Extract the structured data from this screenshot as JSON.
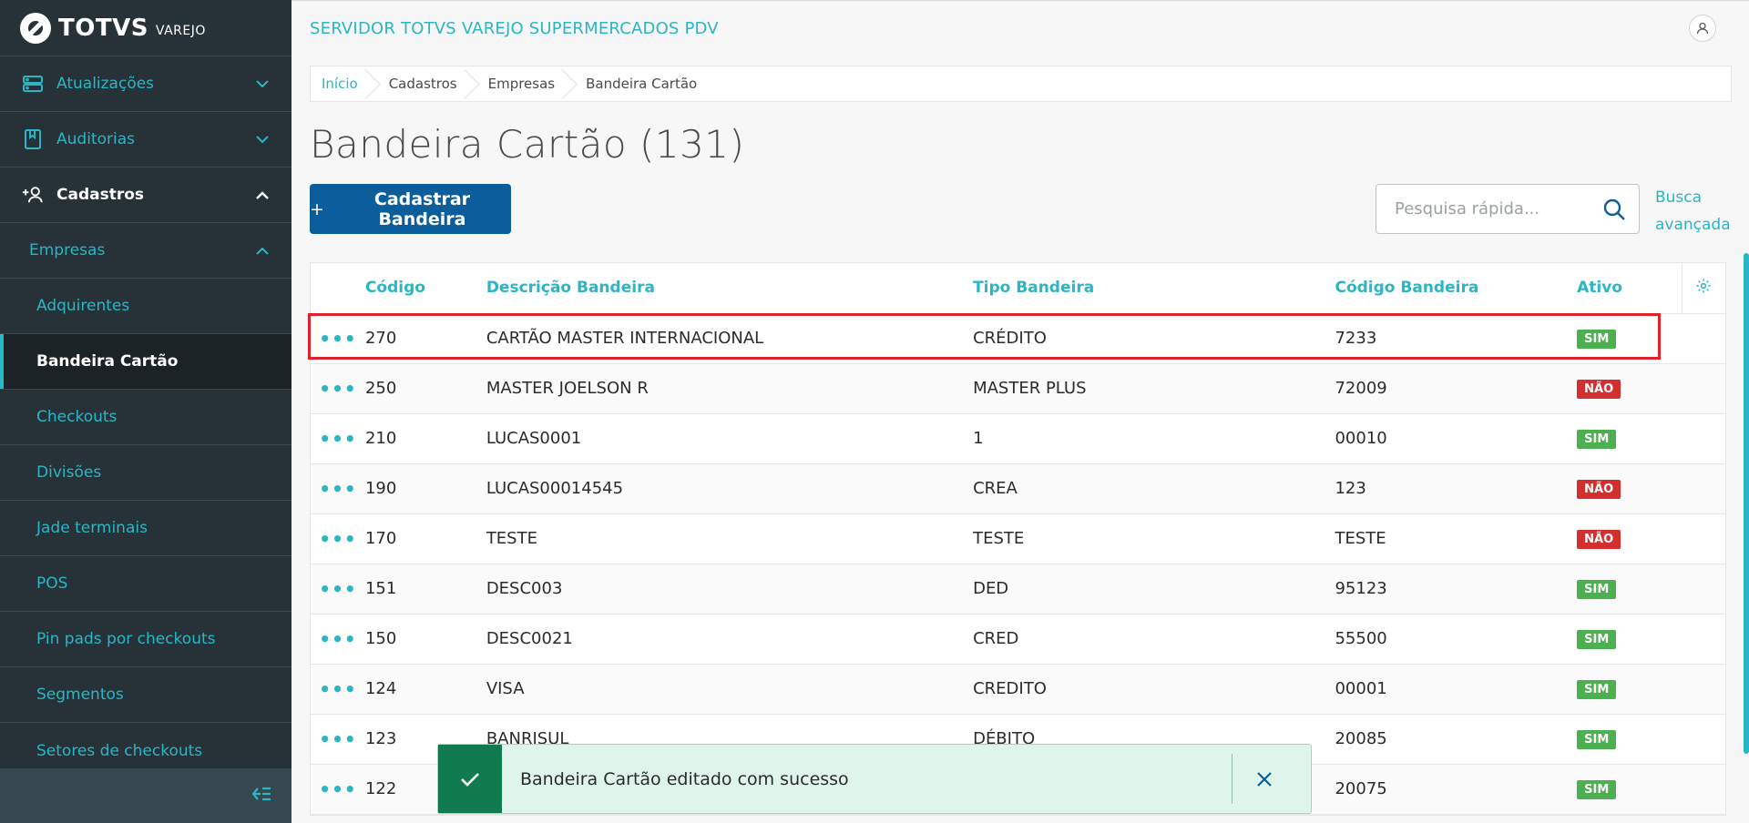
{
  "sidebar": {
    "logo_text": "TOTVS",
    "logo_sub": "VAREJO",
    "items": [
      {
        "label": "Atualizações",
        "icon": "server-icon"
      },
      {
        "label": "Auditorias",
        "icon": "book-icon"
      },
      {
        "label": "Cadastros",
        "icon": "add-user-icon"
      },
      {
        "label": "Empresas"
      },
      {
        "label": "Adquirentes"
      },
      {
        "label": "Bandeira Cartão"
      },
      {
        "label": "Checkouts"
      },
      {
        "label": "Divisões"
      },
      {
        "label": "Jade terminais"
      },
      {
        "label": "POS"
      },
      {
        "label": "Pin pads por checkouts"
      },
      {
        "label": "Segmentos"
      },
      {
        "label": "Setores de checkouts"
      }
    ]
  },
  "header": {
    "app_title": "SERVIDOR TOTVS VAREJO SUPERMERCADOS PDV"
  },
  "breadcrumb": [
    "Início",
    "Cadastros",
    "Empresas",
    "Bandeira Cartão"
  ],
  "page": {
    "title": "Bandeira Cartão (131)",
    "add_button": "Cadastrar Bandeira",
    "search_placeholder": "Pesquisa rápida...",
    "advanced_search_line1": "Busca",
    "advanced_search_line2": "avançada"
  },
  "table": {
    "columns": [
      "Código",
      "Descrição Bandeira",
      "Tipo Bandeira",
      "Código Bandeira",
      "Ativo"
    ],
    "rows": [
      {
        "codigo": "270",
        "descricao": "CARTÃO MASTER INTERNACIONAL",
        "tipo": "CRÉDITO",
        "codigo_bandeira": "7233",
        "ativo": "SIM"
      },
      {
        "codigo": "250",
        "descricao": "MASTER JOELSON R",
        "tipo": "MASTER PLUS",
        "codigo_bandeira": "72009",
        "ativo": "NÃO"
      },
      {
        "codigo": "210",
        "descricao": "LUCAS0001",
        "tipo": "1",
        "codigo_bandeira": "00010",
        "ativo": "SIM"
      },
      {
        "codigo": "190",
        "descricao": "LUCAS00014545",
        "tipo": "CREA",
        "codigo_bandeira": "123",
        "ativo": "NÃO"
      },
      {
        "codigo": "170",
        "descricao": "TESTE",
        "tipo": "TESTE",
        "codigo_bandeira": "TESTE",
        "ativo": "NÃO"
      },
      {
        "codigo": "151",
        "descricao": "DESC003",
        "tipo": "DED",
        "codigo_bandeira": "95123",
        "ativo": "SIM"
      },
      {
        "codigo": "150",
        "descricao": "DESC0021",
        "tipo": "CRED",
        "codigo_bandeira": "55500",
        "ativo": "SIM"
      },
      {
        "codigo": "124",
        "descricao": "VISA",
        "tipo": "CREDITO",
        "codigo_bandeira": "00001",
        "ativo": "SIM"
      },
      {
        "codigo": "123",
        "descricao": "BANRISUL",
        "tipo": "DÉBITO",
        "codigo_bandeira": "20085",
        "ativo": "SIM"
      },
      {
        "codigo": "122",
        "descricao": "",
        "tipo": "",
        "codigo_bandeira": "20075",
        "ativo": "SIM"
      }
    ]
  },
  "toast": {
    "message": "Bandeira Cartão editado com sucesso"
  },
  "colors": {
    "accent": "#29b6c5",
    "primary_button": "#0c5d9c",
    "sidebar_bg": "#263238",
    "success": "#0f7b4f",
    "badge_sim": "#4caf50",
    "badge_nao": "#d32f2f",
    "highlight": "#e0202a"
  }
}
